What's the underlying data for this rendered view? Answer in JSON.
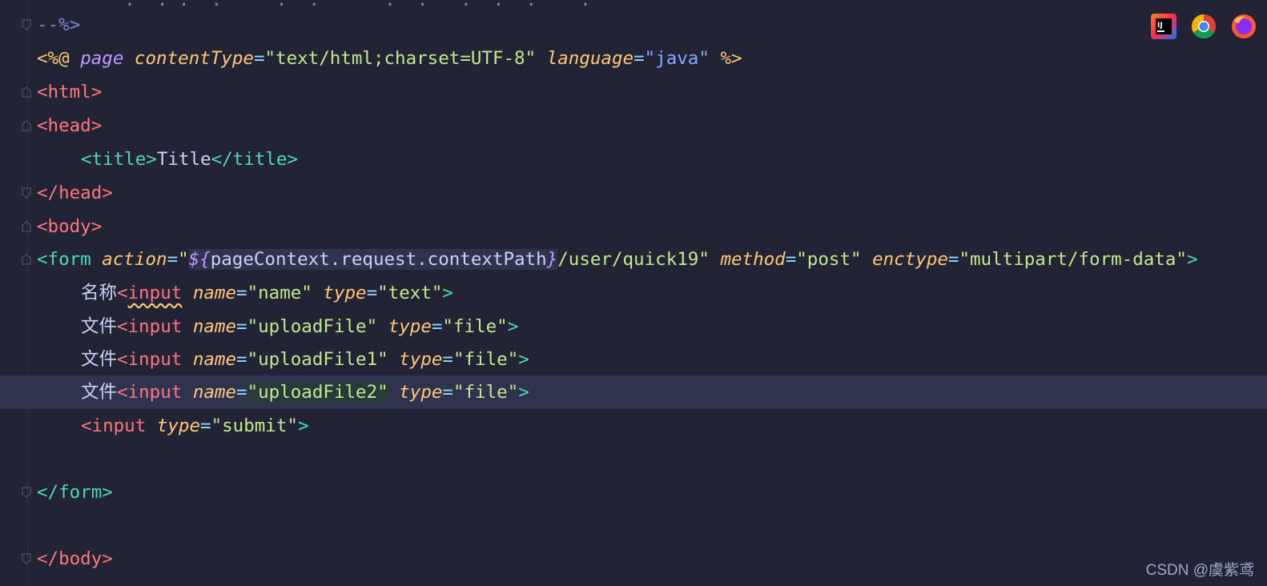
{
  "editor": {
    "lines": [
      {
        "top_fragment": "<%-- ... --%>"
      },
      {
        "text": "--%>"
      }
    ],
    "jsp_directive": {
      "open": "<%@",
      "keyword": "page",
      "attr1": "contentType",
      "val1": "\"text/html;charset=UTF-8\"",
      "attr2": "language",
      "val2": "\"java\"",
      "close": "%>"
    },
    "tags": {
      "html": "html",
      "head": "head",
      "title": "title",
      "title_text": "Title",
      "body": "body",
      "form": "form",
      "input": "input"
    },
    "form": {
      "action_attr": "action",
      "el_open": "${",
      "el_expr": "pageContext.request.contextPath",
      "el_close": "}",
      "action_rest": "/user/quick19\"",
      "method_attr": "method",
      "method_val": "\"post\"",
      "enctype_attr": "enctype",
      "enctype_val": "\"multipart/form-data\""
    },
    "inputs": [
      {
        "label": "名称",
        "name_val": "\"name\"",
        "type_val": "\"text\""
      },
      {
        "label": "文件",
        "name_val": "\"uploadFile\"",
        "type_val": "\"file\""
      },
      {
        "label": "文件",
        "name_val": "\"uploadFile1\"",
        "type_val": "\"file\""
      },
      {
        "label": "文件",
        "name_val": "\"uploadFile2\"",
        "type_val": "\"file\""
      }
    ],
    "submit": {
      "type_val": "\"submit\""
    },
    "attr_names": {
      "name": "name",
      "type": "type"
    }
  },
  "browser_icons": [
    "intellij-icon",
    "chrome-icon",
    "firefox-icon"
  ],
  "watermark": "CSDN @虞紫鸢",
  "colors": {
    "background": "#222436",
    "current_line": "#2f334d",
    "tag": "#ff757f",
    "attr": "#ffc777",
    "string": "#c3e88d"
  }
}
